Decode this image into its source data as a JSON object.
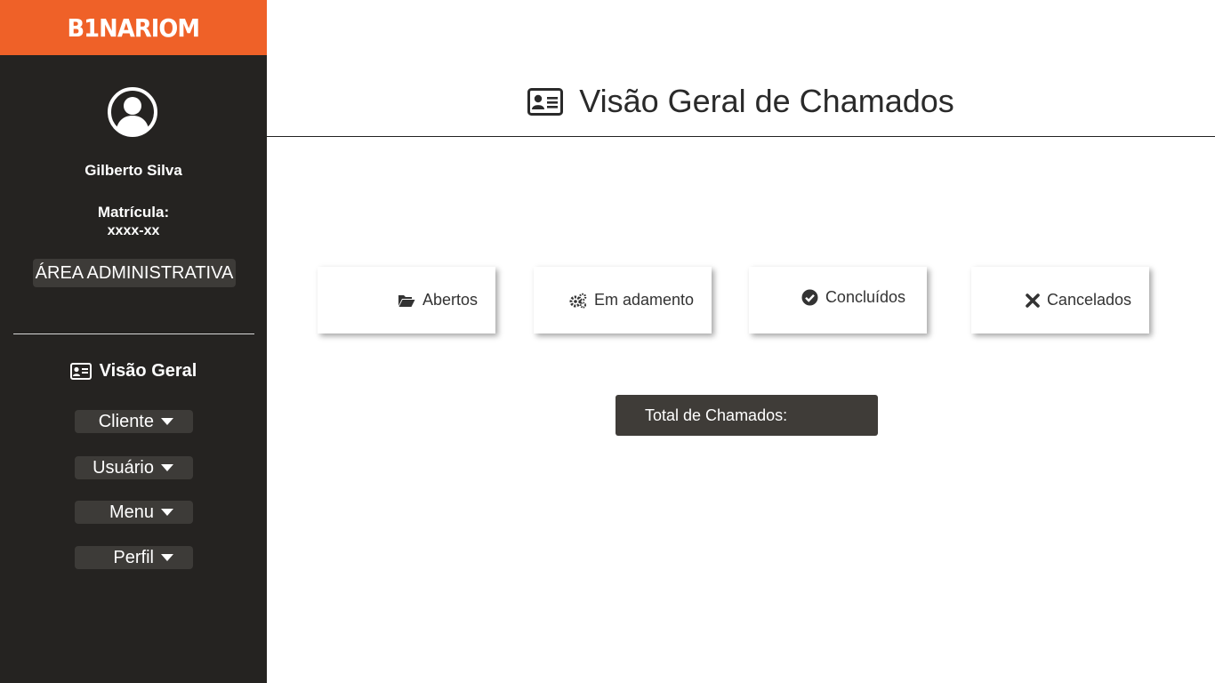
{
  "brand": {
    "logo_text": "B1NARIOM",
    "color": "#ef6128"
  },
  "sidebar": {
    "user_name": "Gilberto Silva",
    "matricula_label": "Matrícula:",
    "matricula_value": "xxxx-xx",
    "area_label": "ÁREA ADMINISTRATIVA",
    "overview_label": "Visão Geral",
    "overview_icon": "id-card-icon",
    "menus": [
      {
        "label": "Cliente"
      },
      {
        "label": "Usuário"
      },
      {
        "label": "Menu"
      },
      {
        "label": "Perfil"
      }
    ]
  },
  "main": {
    "title": "Visão Geral de Chamados",
    "title_icon": "id-card-icon",
    "cards": [
      {
        "label": "Abertos",
        "icon": "folder-open-icon"
      },
      {
        "label": "Em adamento",
        "icon": "gears-icon"
      },
      {
        "label": "Concluídos",
        "icon": "check-circle-icon"
      },
      {
        "label": "Cancelados",
        "icon": "close-icon"
      }
    ],
    "total_label": "Total de Chamados:"
  },
  "colors": {
    "sidebar_bg": "#252321",
    "button_bg": "#3d3b38",
    "total_bg": "#3f3c38"
  }
}
